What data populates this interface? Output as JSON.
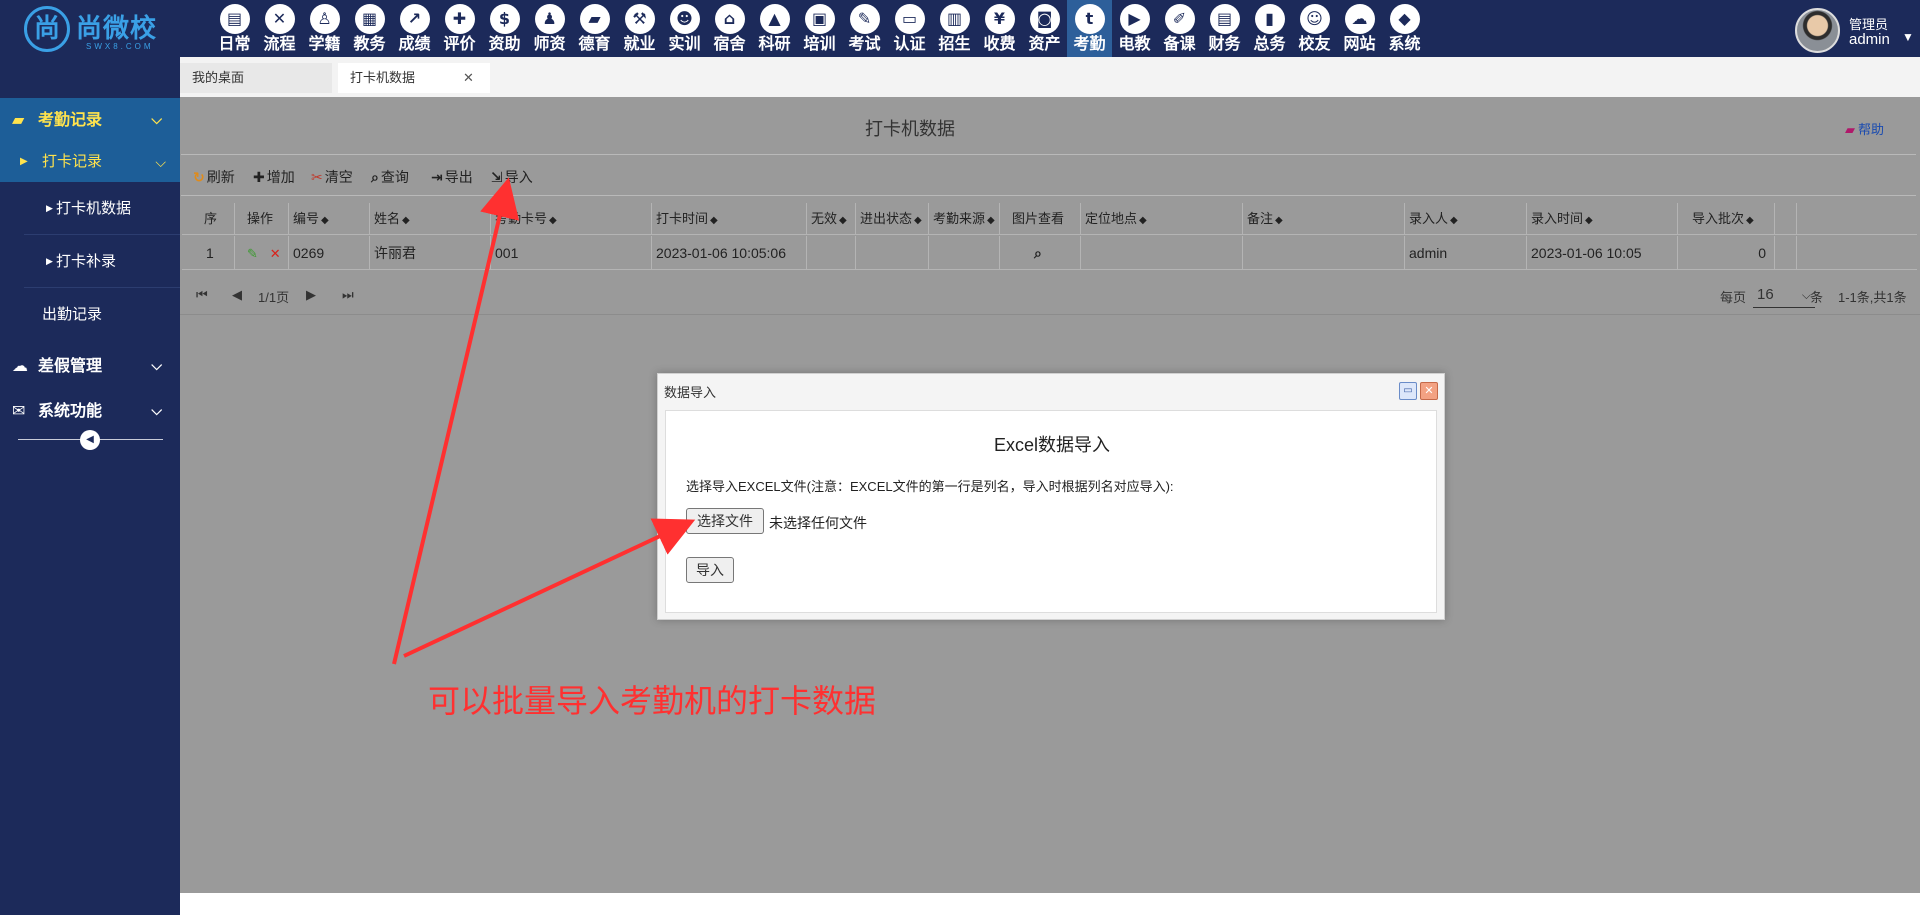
{
  "logo": {
    "mark": "尚",
    "name": "尚微校",
    "sub": "SWX8.COM"
  },
  "nav": [
    {
      "label": "日常",
      "icon": "calendar-icon",
      "glyph": "▤",
      "active": false
    },
    {
      "label": "流程",
      "icon": "flow-icon",
      "glyph": "✕",
      "active": false
    },
    {
      "label": "学籍",
      "icon": "student-icon",
      "glyph": "♙",
      "active": false
    },
    {
      "label": "教务",
      "icon": "schedule-icon",
      "glyph": "▦",
      "active": false
    },
    {
      "label": "成绩",
      "icon": "chart-icon",
      "glyph": "↗",
      "active": false
    },
    {
      "label": "评价",
      "icon": "evaluate-icon",
      "glyph": "✚",
      "active": false
    },
    {
      "label": "资助",
      "icon": "aid-icon",
      "glyph": "$",
      "active": false
    },
    {
      "label": "师资",
      "icon": "teacher-icon",
      "glyph": "♟",
      "active": false
    },
    {
      "label": "德育",
      "icon": "book-icon",
      "glyph": "▰",
      "active": false
    },
    {
      "label": "就业",
      "icon": "hammer-icon",
      "glyph": "⚒",
      "active": false
    },
    {
      "label": "实训",
      "icon": "training-icon",
      "glyph": "☻",
      "active": false
    },
    {
      "label": "宿舍",
      "icon": "house-icon",
      "glyph": "⌂",
      "active": false
    },
    {
      "label": "科研",
      "icon": "graduation-icon",
      "glyph": "▲",
      "active": false
    },
    {
      "label": "培训",
      "icon": "image-icon",
      "glyph": "▣",
      "active": false
    },
    {
      "label": "考试",
      "icon": "wrench-icon",
      "glyph": "✎",
      "active": false
    },
    {
      "label": "认证",
      "icon": "monitor-icon",
      "glyph": "▭",
      "active": false
    },
    {
      "label": "招生",
      "icon": "bus-icon",
      "glyph": "▥",
      "active": false
    },
    {
      "label": "收费",
      "icon": "yen-icon",
      "glyph": "¥",
      "active": false
    },
    {
      "label": "资产",
      "icon": "train-icon",
      "glyph": "◙",
      "active": false
    },
    {
      "label": "考勤",
      "icon": "attendance-icon",
      "glyph": "t",
      "active": true
    },
    {
      "label": "电教",
      "icon": "media-icon",
      "glyph": "▶",
      "active": false
    },
    {
      "label": "备课",
      "icon": "edit-icon",
      "glyph": "✐",
      "active": false
    },
    {
      "label": "财务",
      "icon": "newspaper-icon",
      "glyph": "▤",
      "active": false
    },
    {
      "label": "总务",
      "icon": "bars-icon",
      "glyph": "▮",
      "active": false
    },
    {
      "label": "校友",
      "icon": "group-icon",
      "glyph": "☺",
      "active": false
    },
    {
      "label": "网站",
      "icon": "cloud-icon",
      "glyph": "☁",
      "active": false
    },
    {
      "label": "系统",
      "icon": "cube-icon",
      "glyph": "◆",
      "active": false
    }
  ],
  "user": {
    "role": "管理员",
    "name": "admin"
  },
  "sidebar": {
    "group1": "考勤记录",
    "sub1": "打卡记录",
    "leaf1": "打卡机数据",
    "leaf2": "打卡补录",
    "plain1": "出勤记录",
    "group2": "差假管理",
    "group3": "系统功能"
  },
  "tabs": {
    "home": "我的桌面",
    "current": "打卡机数据"
  },
  "page": {
    "title": "打卡机数据",
    "help": "帮助"
  },
  "toolbar": {
    "refresh": "刷新",
    "add": "增加",
    "clear": "清空",
    "query": "查询",
    "export": "导出",
    "import": "导入"
  },
  "grid": {
    "headers": [
      "序",
      "操作",
      "编号",
      "姓名",
      "考勤卡号",
      "打卡时间",
      "无效",
      "进出状态",
      "考勤来源",
      "图片查看",
      "定位地点",
      "备注",
      "录入人",
      "录入时间",
      "导入批次"
    ],
    "row": {
      "seq": "1",
      "code": "0269",
      "name": "许丽君",
      "card": "001",
      "time": "2023-01-06 10:05:06",
      "invalid": "",
      "status": "",
      "source": "",
      "location": "",
      "remark": "",
      "entered_by": "admin",
      "entered_at": "2023-01-06 10:05",
      "batch": "0"
    }
  },
  "pager": {
    "page_info": "1/1页",
    "per_page_label": "每页",
    "per_page_value": "16",
    "unit": "条",
    "summary": "1-1条,共1条"
  },
  "dialog": {
    "title": "数据导入",
    "heading": "Excel数据导入",
    "note": "选择导入EXCEL文件(注意：EXCEL文件的第一行是列名，导入时根据列名对应导入):",
    "file_button": "选择文件",
    "file_status": "未选择任何文件",
    "import_button": "导入"
  },
  "annotation": {
    "text": "可以批量导入考勤机的打卡数据",
    "color": "#ff3030"
  }
}
